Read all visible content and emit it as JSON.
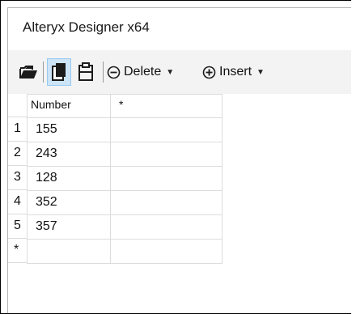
{
  "window": {
    "title": "Alteryx Designer x64"
  },
  "toolbar": {
    "delete_label": "Delete",
    "insert_label": "Insert"
  },
  "grid": {
    "columns": [
      "Number",
      "*"
    ],
    "rows": [
      {
        "index": "1",
        "number": "155",
        "new": ""
      },
      {
        "index": "2",
        "number": "243",
        "new": ""
      },
      {
        "index": "3",
        "number": "128",
        "new": ""
      },
      {
        "index": "4",
        "number": "352",
        "new": ""
      },
      {
        "index": "5",
        "number": "357",
        "new": ""
      }
    ],
    "new_row_marker": "*"
  },
  "icons": {
    "open": "folder-open-icon",
    "copy": "copy-icon",
    "paste": "clipboard-icon",
    "delete": "minus-circle-icon",
    "insert": "plus-circle-icon"
  }
}
